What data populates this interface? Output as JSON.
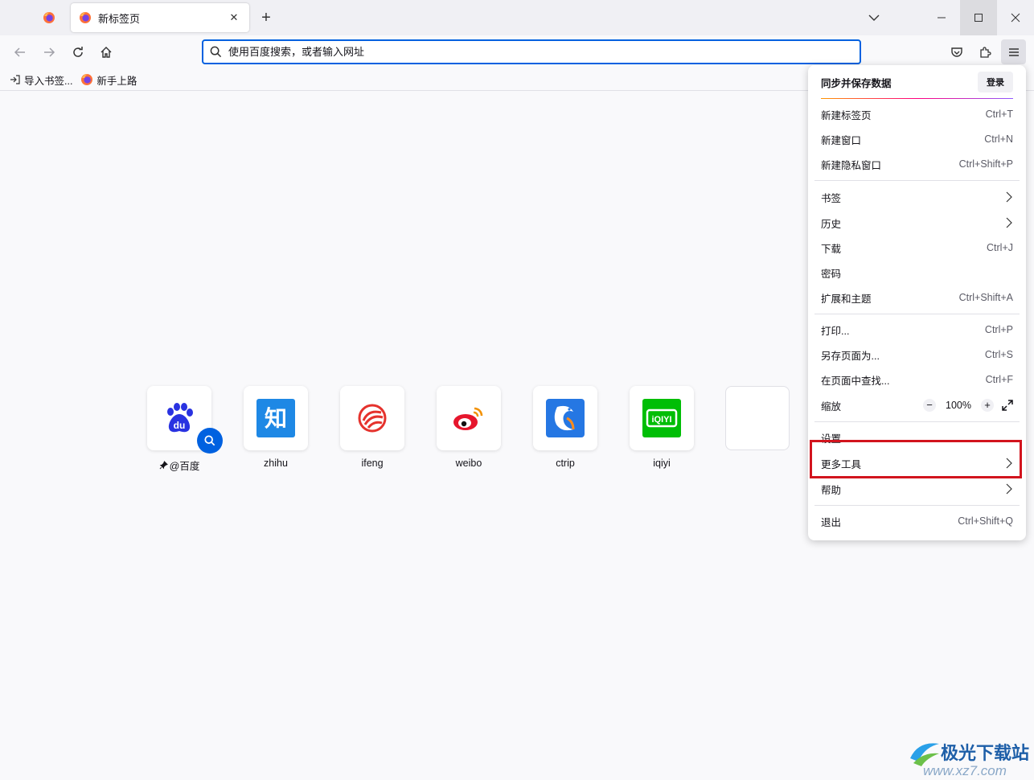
{
  "tabs": {
    "active_title": "新标签页",
    "close_symbol": "✕",
    "new_tab_symbol": "+"
  },
  "urlbar": {
    "placeholder": "使用百度搜索，或者输入网址"
  },
  "bookmarks": [
    {
      "label": "导入书签..."
    },
    {
      "label": "新手上路"
    }
  ],
  "topsites": [
    {
      "label": "@百度",
      "icon": "baidu-icon",
      "color": "#2932e1"
    },
    {
      "label": "zhihu",
      "icon": "zhihu-icon",
      "color": "#1e88e5"
    },
    {
      "label": "ifeng",
      "icon": "ifeng-icon",
      "color": "#e5322d"
    },
    {
      "label": "weibo",
      "icon": "weibo-icon",
      "color": "#e6162d"
    },
    {
      "label": "ctrip",
      "icon": "ctrip-icon",
      "color": "#2577e3"
    },
    {
      "label": "iqiyi",
      "icon": "iqiyi-icon",
      "color": "#00be06"
    }
  ],
  "zhihu_glyph": "知",
  "iqiyi_glyph": "iQIYI",
  "baidu_glyph": "du",
  "app_menu": {
    "sync_title": "同步并保存数据",
    "signin_label": "登录",
    "items": {
      "new_tab": {
        "label": "新建标签页",
        "shortcut": "Ctrl+T"
      },
      "new_window": {
        "label": "新建窗口",
        "shortcut": "Ctrl+N"
      },
      "new_private": {
        "label": "新建隐私窗口",
        "shortcut": "Ctrl+Shift+P"
      },
      "bookmarks": {
        "label": "书签"
      },
      "history": {
        "label": "历史"
      },
      "downloads": {
        "label": "下载",
        "shortcut": "Ctrl+J"
      },
      "passwords": {
        "label": "密码"
      },
      "addons": {
        "label": "扩展和主题",
        "shortcut": "Ctrl+Shift+A"
      },
      "print": {
        "label": "打印...",
        "shortcut": "Ctrl+P"
      },
      "save_as": {
        "label": "另存页面为...",
        "shortcut": "Ctrl+S"
      },
      "find": {
        "label": "在页面中查找...",
        "shortcut": "Ctrl+F"
      },
      "zoom": {
        "label": "缩放",
        "value": "100%",
        "minus": "−",
        "plus": "+"
      },
      "settings": {
        "label": "设置"
      },
      "more_tools": {
        "label": "更多工具"
      },
      "help": {
        "label": "帮助"
      },
      "quit": {
        "label": "退出",
        "shortcut": "Ctrl+Shift+Q"
      }
    }
  },
  "watermark": {
    "title": "极光下载站",
    "sub": "www.xz7.com"
  },
  "colors": {
    "accent": "#0061e0",
    "highlight": "#d2141e"
  }
}
